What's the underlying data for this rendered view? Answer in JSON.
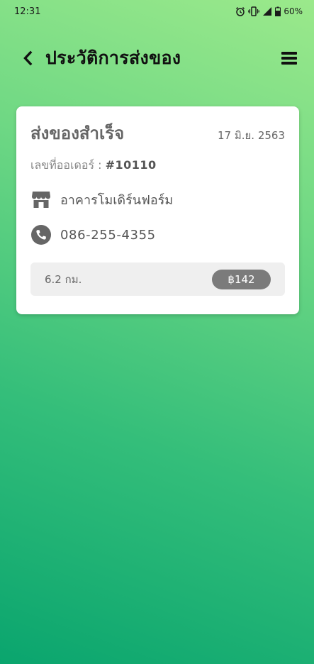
{
  "status_bar": {
    "time": "12:31",
    "battery": "60%"
  },
  "header": {
    "title": "ประวัติการส่งของ"
  },
  "order": {
    "status": "ส่งของสำเร็จ",
    "date": "17 มิ.ย. 2563",
    "order_label": "เลขที่ออเดอร์ :",
    "order_number": "#10110",
    "store_name": "อาคารโมเดิร์นฟอร์ม",
    "phone": "086-255-4355",
    "distance": "6.2 กม.",
    "price": "฿142"
  },
  "icons": {
    "back": "chevron-left-icon",
    "menu": "hamburger-menu-icon",
    "store": "store-icon",
    "phone": "phone-icon",
    "alarm": "alarm-icon",
    "vibrate": "vibrate-icon",
    "signal": "signal-icon",
    "battery": "battery-icon"
  },
  "colors": {
    "gradient_top": "#9BE98B",
    "gradient_bottom": "#0AA56E",
    "card_bg": "#FFFFFF",
    "pill_bg": "#7B7B7B",
    "summary_bg": "#EFEFEF"
  }
}
